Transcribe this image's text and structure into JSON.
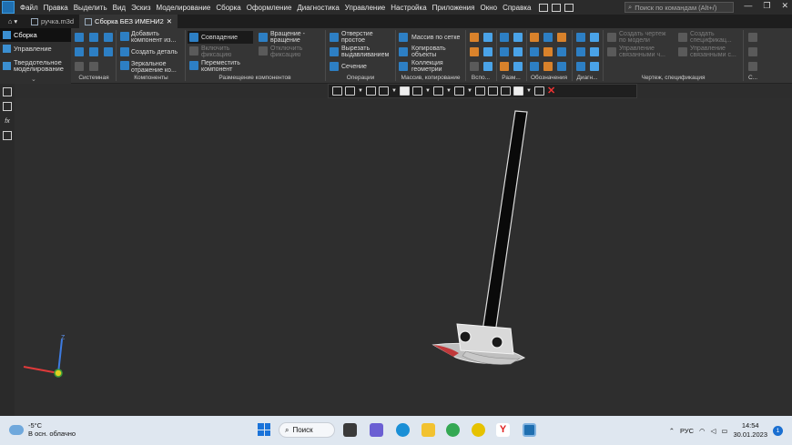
{
  "menu": {
    "items": [
      "Файл",
      "Правка",
      "Выделить",
      "Вид",
      "Эскиз",
      "Моделирование",
      "Сборка",
      "Оформление",
      "Диагностика",
      "Управление",
      "Настройка",
      "Приложения",
      "Окно",
      "Справка"
    ],
    "search_placeholder": "Поиск по командам (Alt+/)"
  },
  "tabs": [
    {
      "label": "ручка.m3d",
      "active": false
    },
    {
      "label": "Сборка БЕЗ ИМЕНИ2",
      "active": true,
      "close": "✕"
    }
  ],
  "left_panel": {
    "items": [
      "Сборка",
      "Управление",
      "Твердотельное\nмоделирование"
    ],
    "active_index": 0
  },
  "ribbon": {
    "components": [
      "Добавить\nкомпонент из...",
      "Создать деталь",
      "Зеркальное\nотражение ко..."
    ],
    "placement": [
      "Совпадение",
      "Включить\nфиксацию",
      "Переместить\nкомпонент",
      "Вращение -\nвращение",
      "Отключить\nфиксацию"
    ],
    "operations": [
      "Отверстие\nпростое",
      "Вырезать\nвыдавливанием",
      "Сечение"
    ],
    "arrays": [
      "Массив по сетке",
      "Копировать\nобъекты",
      "Коллекция\nгеометрии"
    ],
    "drawing": [
      "Создать чертеж\nпо модели",
      "Управление\nсвязанными ч...",
      "Создать\nспецификац...",
      "Управление\nсвязанными с..."
    ],
    "group_labels": [
      "Системная",
      "Компоненты",
      "Размещение компонентов",
      "Операции",
      "Массив, копирование",
      "Вспо...",
      "Разм...",
      "Обозначения",
      "Диагн...",
      "Чертеж, спецификация",
      "С..."
    ]
  },
  "viewport": {
    "axis_labels": {
      "z": "Z"
    }
  },
  "taskbar": {
    "weather_temp": "-5°C",
    "weather_desc": "В осн. облачно",
    "search_label": "Поиск",
    "lang": "РУС",
    "time": "14:54",
    "date": "30.01.2023",
    "notifications": "1"
  }
}
